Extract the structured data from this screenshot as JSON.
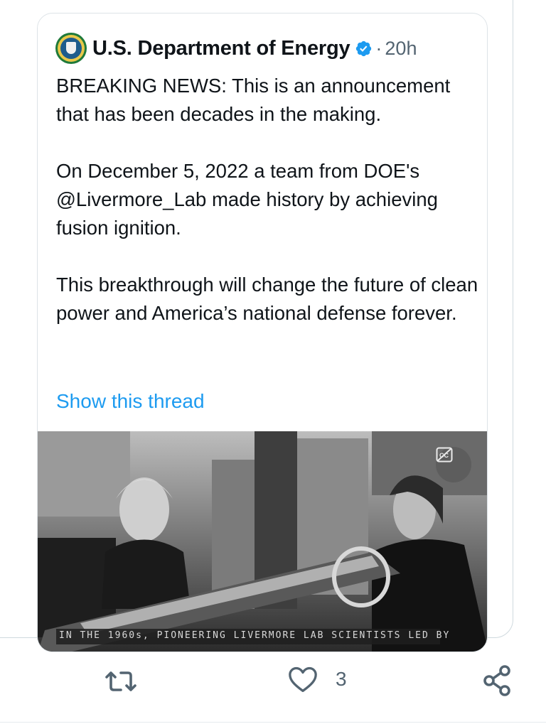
{
  "quoted_tweet": {
    "author": "U.S. Department of Energy",
    "separator": "·",
    "time": "20h",
    "paragraphs": [
      "BREAKING NEWS: This is an announcement that has been decades in the making.",
      "On December 5, 2022 a team from DOE's @Livermore_Lab made history by achieving fusion ignition.",
      "This breakthrough will change the future of clean power and America’s national defense forever."
    ],
    "show_thread": "Show this thread",
    "media": {
      "caption": "IN THE 1960s, PIONEERING LIVERMORE LAB SCIENTISTS LED BY"
    }
  },
  "actions": {
    "like_count": "3"
  },
  "icons": {
    "avatar": "doe-seal-avatar",
    "verified": "verified-badge-icon",
    "cc": "closed-captions-icon",
    "retweet": "retweet-icon",
    "like": "heart-icon",
    "share": "share-icon"
  },
  "colors": {
    "link": "#1d9bf0",
    "verified": "#1d9bf0",
    "secondary_text": "#536471",
    "border": "#cfd9de"
  }
}
